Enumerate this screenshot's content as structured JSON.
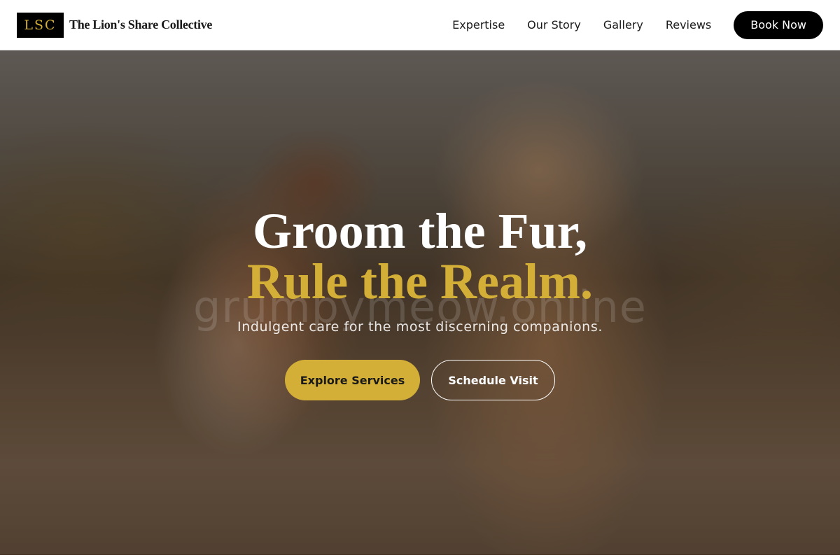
{
  "colors": {
    "accent": "#d4af37",
    "nav_bg": "#ffffff",
    "text_dark": "#1a1a1a",
    "button_dark": "#000000"
  },
  "brand": {
    "logo_text": "LSC",
    "name": "The Lion's Share Collective"
  },
  "nav": {
    "links": [
      "Expertise",
      "Our Story",
      "Gallery",
      "Reviews"
    ],
    "cta": "Book Now"
  },
  "hero": {
    "headline_line1": "Groom the Fur,",
    "headline_line2": "Rule the Realm.",
    "watermark": "grumpymeow.online",
    "subtitle": "Indulgent care for the most discerning companions.",
    "primary_button": "Explore Services",
    "secondary_button": "Schedule Visit",
    "image_description_icon": "two-dogs-running-photo"
  }
}
